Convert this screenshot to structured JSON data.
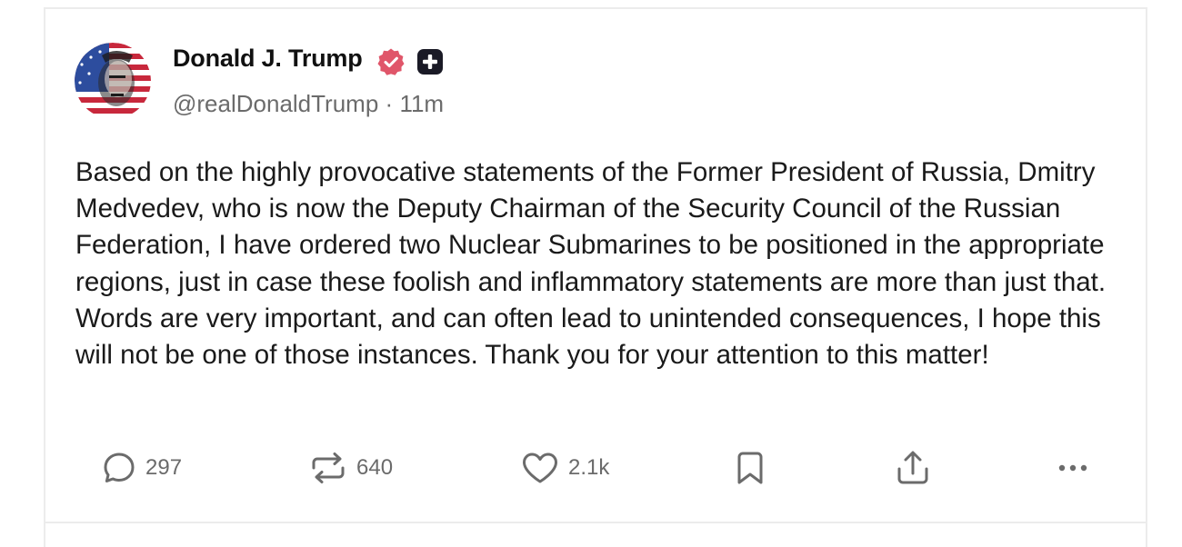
{
  "post": {
    "author": {
      "name": "Donald J. Trump",
      "handle": "@realDonaldTrump",
      "separator": "·",
      "time_ago": "11m",
      "avatar_icon": "flag-portrait-avatar",
      "verified_icon": "verified-badge-icon",
      "plus_icon": "plus-badge-icon"
    },
    "body": "Based on the highly provocative statements of the Former President of Russia, Dmitry Medvedev, who is now the Deputy Chairman of the Security Council of the Russian Federation, I have ordered two Nuclear Submarines to be positioned in the appropriate regions, just in case these foolish and inflammatory statements are more than just that. Words are very important, and can often lead to unintended consequences, I hope this will not be one of those instances. Thank you for your attention to this matter!",
    "actions": {
      "replies": {
        "icon": "reply-icon",
        "count": "297"
      },
      "retruths": {
        "icon": "repost-icon",
        "count": "640"
      },
      "likes": {
        "icon": "heart-icon",
        "count": "2.1k"
      },
      "bookmark": {
        "icon": "bookmark-icon"
      },
      "share": {
        "icon": "share-icon"
      },
      "more": {
        "icon": "more-icon"
      }
    }
  },
  "colors": {
    "text_primary": "#1a1a1a",
    "text_secondary": "#6b6b6b",
    "verified_badge": "#e0566a",
    "border": "#ececec"
  }
}
